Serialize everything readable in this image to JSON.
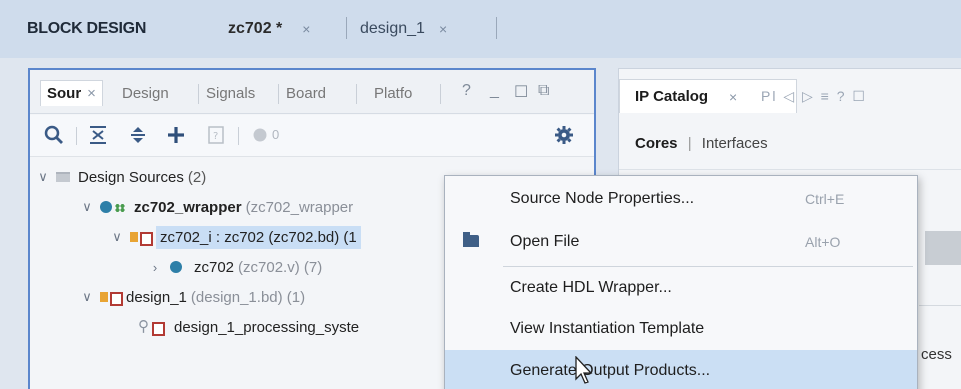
{
  "header": {
    "title": "BLOCK DESIGN",
    "tabs": [
      {
        "label": "zc702 *",
        "active": true
      },
      {
        "label": "design_1",
        "active": false
      }
    ],
    "close_glyph": "×"
  },
  "sources_panel": {
    "tabs": [
      "Sour",
      "Design",
      "Signals",
      "Board",
      "Platfo"
    ],
    "help": "?",
    "toolbar_count": "0",
    "tree": [
      {
        "label": "Design Sources",
        "sub": "(2)"
      },
      {
        "label": "zc702_wrapper",
        "sub": "(zc702_wrapper"
      },
      {
        "label": "zc702_i : zc702 (zc702.bd) (1"
      },
      {
        "label": "zc702",
        "sub": "(zc702.v) (7)"
      },
      {
        "label": "design_1",
        "sub": "(design_1.bd) (1)"
      },
      {
        "label": "design_1_processing_syste"
      }
    ]
  },
  "ip_panel": {
    "title": "IP Catalog",
    "mini_tabs": "Pl ◁ ▷ ≡ ? ☐",
    "sub_active": "Cores",
    "sub_sep": "|",
    "sub_other": "Interfaces",
    "partial_text": "cess"
  },
  "context_menu": {
    "items": [
      {
        "label": "Source Node Properties...",
        "shortcut": "Ctrl+E"
      },
      {
        "label": "Open File",
        "shortcut": "Alt+O"
      },
      {
        "label": "Create HDL Wrapper...",
        "shortcut": ""
      },
      {
        "label": "View Instantiation Template",
        "shortcut": ""
      },
      {
        "label": "Generate Output Products...",
        "shortcut": ""
      }
    ]
  },
  "colors": {
    "accent": "#5b86cc",
    "selection": "#c9def5",
    "menu_hover": "#cbdff4"
  }
}
